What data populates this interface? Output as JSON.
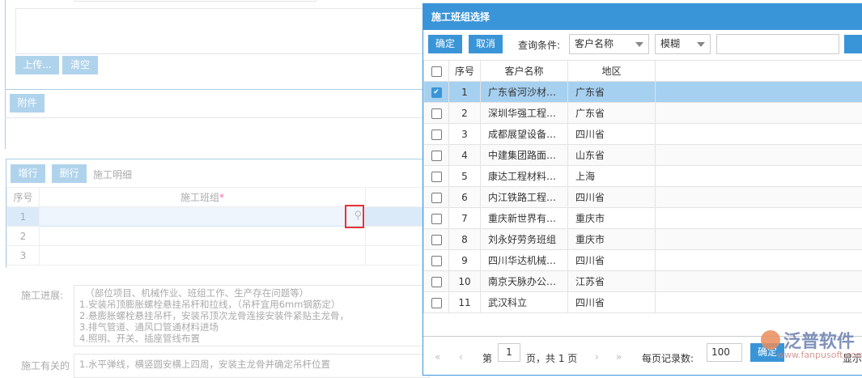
{
  "background_form": {
    "upload_label": "上传...",
    "clear_label": "清空",
    "attachment_label": "附件",
    "add_row_label": "增行",
    "delete_row_label": "删行",
    "detail_title": "施工明细",
    "table_headers": [
      "序号",
      "施工班组"
    ],
    "required_mark": "*",
    "rows": [
      "1",
      "2",
      "3"
    ],
    "progress_label": "施工进展:",
    "progress_text": "  （部位项目、机械作业、班组工作、生产存在问题等）\n1.安装吊顶膨胀螺栓悬挂吊杆和拉线，（吊杆宜用6mm钢筋定）\n2.悬膨胀螺栓悬挂吊杆，安装吊顶次龙骨连接安装件紧贴主龙骨，\n3.排气管道、通风口管通材料进场\n4.照明、开关、插座管线布置",
    "next_label": "施工有关的",
    "next_text": "1.水平弹线，横竖圆安横上四周，安装主龙骨并确定吊杆位置"
  },
  "modal": {
    "title": "施工班组选择",
    "confirm_label": "确定",
    "cancel_label": "取消",
    "query_label": "查询条件:",
    "field_select": "客户名称",
    "match_select": "模糊",
    "search_value": "",
    "headers": [
      "序号",
      "客户名称",
      "地区"
    ],
    "rows": [
      {
        "no": "1",
        "name": "广东省河沙材…",
        "region": "广东省",
        "checked": true
      },
      {
        "no": "2",
        "name": "深圳华强工程…",
        "region": "广东省",
        "checked": false
      },
      {
        "no": "3",
        "name": "成都展望设备…",
        "region": "四川省",
        "checked": false
      },
      {
        "no": "4",
        "name": "中建集团路面…",
        "region": "山东省",
        "checked": false
      },
      {
        "no": "5",
        "name": "康达工程材料…",
        "region": "上海",
        "checked": false
      },
      {
        "no": "6",
        "name": "内江铁路工程…",
        "region": "四川省",
        "checked": false
      },
      {
        "no": "7",
        "name": "重庆新世界有…",
        "region": "重庆市",
        "checked": false
      },
      {
        "no": "8",
        "name": "刘永好劳务班组",
        "region": "重庆市",
        "checked": false
      },
      {
        "no": "9",
        "name": "四川华达机械…",
        "region": "四川省",
        "checked": false
      },
      {
        "no": "10",
        "name": "南京天脉办公…",
        "region": "江苏省",
        "checked": false
      },
      {
        "no": "11",
        "name": "武汉科立",
        "region": "四川省",
        "checked": false
      }
    ],
    "pager": {
      "page_prefix": "第",
      "page": "1",
      "page_suffix": "页，共 1 页",
      "per_page_label": "每页记录数:",
      "per_page": "100",
      "go_label": "确定",
      "display_label": "显示"
    }
  },
  "watermark": {
    "brand": "泛普软件",
    "url": "www.fanpusoft.com"
  }
}
